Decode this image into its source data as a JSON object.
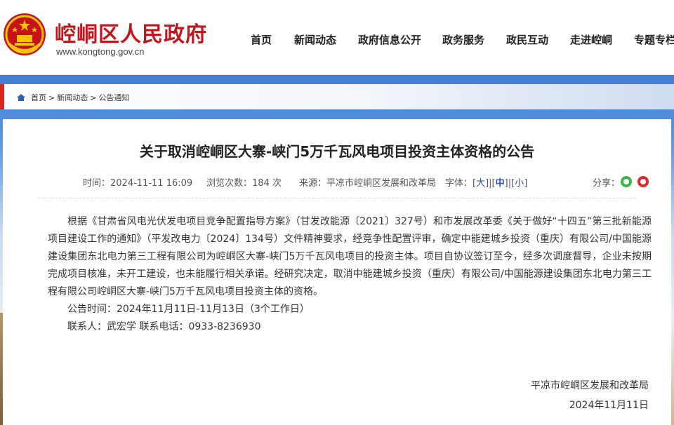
{
  "site": {
    "title": "崆峒区人民政府",
    "url": "www.kongtong.gov.cn"
  },
  "nav": {
    "items": [
      {
        "label": "首页"
      },
      {
        "label": "新闻动态"
      },
      {
        "label": "政府信息公开"
      },
      {
        "label": "政务服务"
      },
      {
        "label": "政民互动"
      },
      {
        "label": "走进崆峒"
      },
      {
        "label": "专题专栏"
      }
    ]
  },
  "breadcrumb": {
    "items": [
      "首页",
      "新闻动态",
      "公告通知"
    ],
    "separator": ">"
  },
  "article": {
    "title": "关于取消崆峒区大寨-峡门5万千瓦风电项目投资主体资格的公告",
    "meta": {
      "time_label": "时间：",
      "time": "2024-11-11 16:09",
      "views_label": "浏览次数：",
      "views": "184",
      "views_unit": "次",
      "source_label": "来源：",
      "source": "平凉市崆峒区发展和改革局",
      "font_label": "字体：",
      "font_large": "大",
      "font_medium": "中",
      "font_small": "小",
      "share_label": "分享："
    },
    "paragraphs": [
      "根据《甘肃省风电光伏发电项目竞争配置指导方案》（甘发改能源〔2021〕327号）和市发展改革委《关于做好“十四五”第三批新能源项目建设工作的通知》（平发改电力〔2024〕134号）文件精神要求，经竞争性配置评审，确定中能建城乡投资（重庆）有限公司/中国能源建设集团东北电力第三工程有限公司为崆峒区大寨-峡门5万千瓦风电项目的投资主体。项目自协议签订至今，经多次调度督导，企业未按期完成项目核准，未开工建设，也未能履行相关承诺。经研究决定，取消中能建城乡投资（重庆）有限公司/中国能源建设集团东北电力第三工程有限公司崆峒区大寨-峡门5万千瓦风电项目投资主体的资格。",
      "公告时间：2024年11月11日-11月13日（3个工作日）",
      "联系人：武宏学  联系电话：0933-8236930"
    ],
    "signoff": {
      "org": "平凉市崆峒区发展和改革局",
      "date": "2024年11月11日"
    }
  },
  "colors": {
    "brand_red": "#c3161c",
    "link_blue": "#2850a8",
    "wechat_green": "#3ab54a",
    "weibo_red": "#e2262b"
  }
}
